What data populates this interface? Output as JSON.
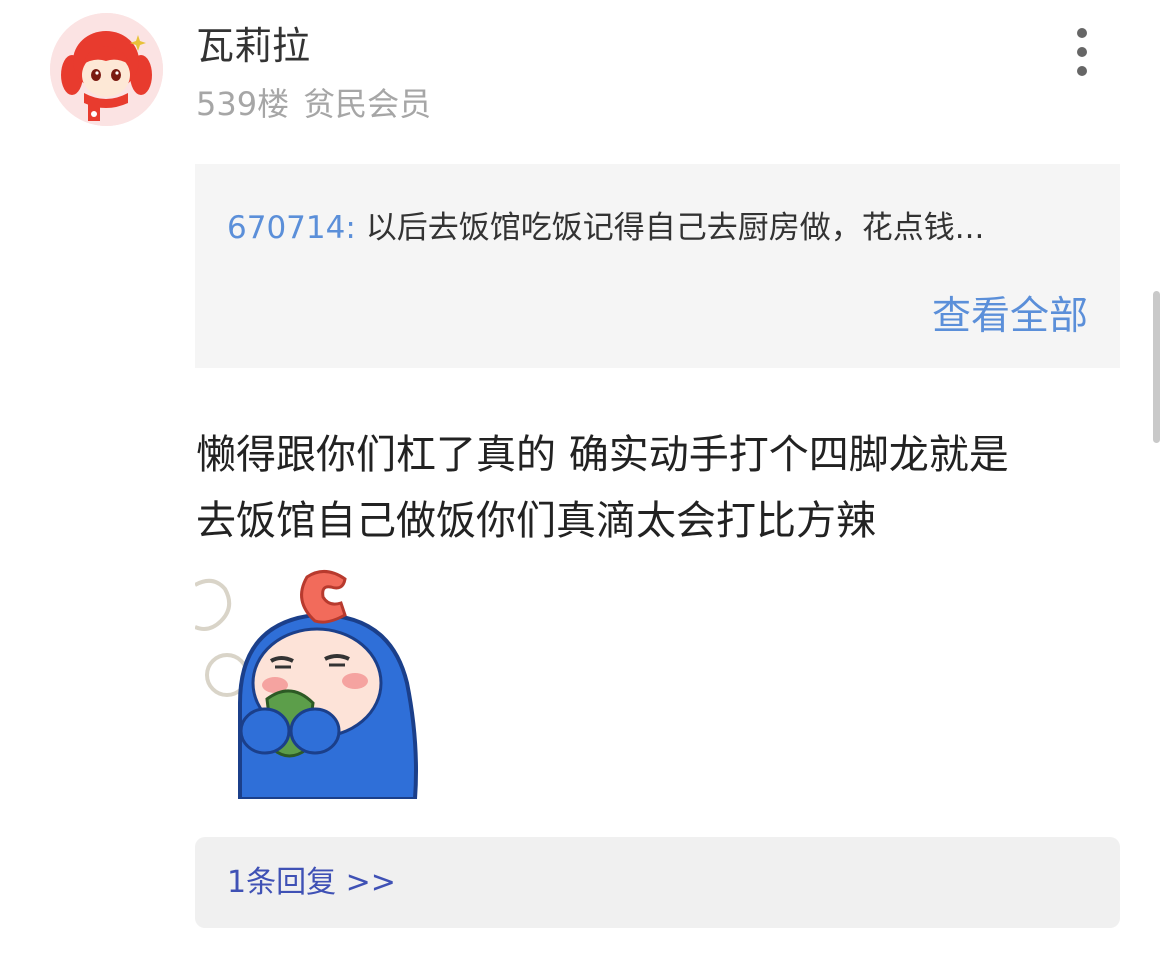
{
  "post": {
    "username": "瓦莉拉",
    "floor": "539楼",
    "member_level": "贫民会员",
    "content_line1": "懒得跟你们杠了真的 确实动手打个四脚龙就是",
    "content_line2": "去饭馆自己做饭你们真滴太会打比方辣"
  },
  "quote": {
    "user": "670714:",
    "text": "以后去饭馆吃饭记得自己去厨房做，花点钱...",
    "view_all_label": "查看全部"
  },
  "replies": {
    "link_label": "1条回复 >>"
  },
  "icons": {
    "more": "more-vertical-icon",
    "avatar": "avatar-red-hair-girl",
    "sticker": "blue-hood-sticker"
  },
  "colors": {
    "link_blue": "#5b8fd9",
    "reply_blue": "#3f51b5",
    "muted": "#a6a6a6",
    "quote_bg": "#f5f5f5",
    "reply_bg": "#f0f0f0"
  }
}
